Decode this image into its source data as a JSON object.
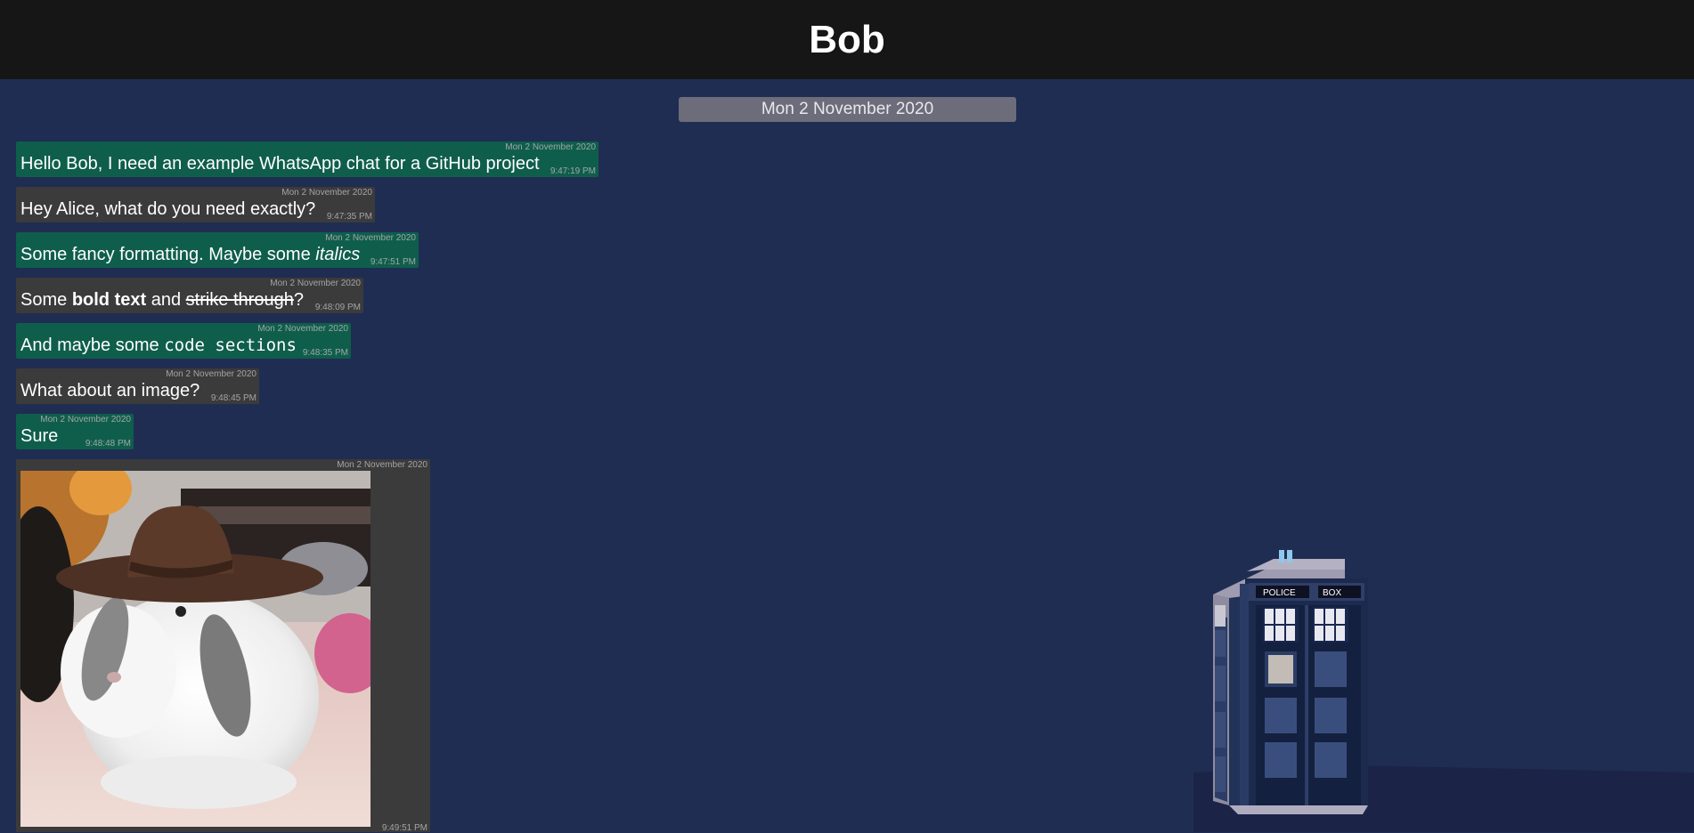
{
  "header": {
    "title": "Bob"
  },
  "date_divider": "Mon 2 November 2020",
  "messages": [
    {
      "dir": "out",
      "date": "Mon 2 November 2020",
      "time": "9:47:19 PM",
      "text": "Hello Bob, I need an example WhatsApp chat for a GitHub project"
    },
    {
      "dir": "in",
      "date": "Mon 2 November 2020",
      "time": "9:47:35 PM",
      "text": "Hey Alice, what do you need exactly?"
    },
    {
      "dir": "out",
      "date": "Mon 2 November 2020",
      "time": "9:47:51 PM",
      "parts": [
        "Some fancy formatting. Maybe some ",
        "italics"
      ]
    },
    {
      "dir": "in",
      "date": "Mon 2 November 2020",
      "time": "9:48:09 PM",
      "parts": [
        "Some ",
        "bold text",
        " and ",
        "strike through",
        "?"
      ]
    },
    {
      "dir": "out",
      "date": "Mon 2 November 2020",
      "time": "9:48:35 PM",
      "parts": [
        "And maybe some ",
        "code sections"
      ]
    },
    {
      "dir": "in",
      "date": "Mon 2 November 2020",
      "time": "9:48:45 PM",
      "text": "What about an image?"
    },
    {
      "dir": "out",
      "date": "Mon 2 November 2020",
      "time": "9:48:48 PM",
      "text": "Sure"
    },
    {
      "dir": "in",
      "date": "Mon 2 November 2020",
      "time": "9:49:51 PM",
      "image": "bunny-in-cowboy-hat-photo"
    }
  ],
  "background": {
    "illustration": "tardis-police-box",
    "sign_left": "POLICE",
    "sign_right": "BOX"
  },
  "colors": {
    "header": "#161616",
    "background": "#1f2d52",
    "outgoing_bubble": "#0f5e4c",
    "incoming_bubble": "#3b3b3b",
    "date_divider": "#6c6c7a"
  }
}
